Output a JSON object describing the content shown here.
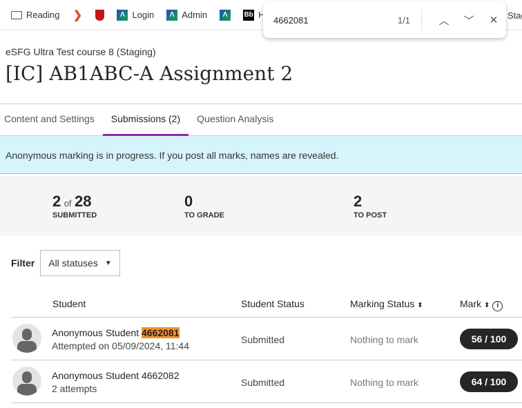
{
  "bookmarks": [
    {
      "label": "Reading",
      "icon": "folder-icon"
    },
    {
      "label": "",
      "icon": "red-chevron-icon"
    },
    {
      "label": "",
      "icon": "crest-icon"
    },
    {
      "label": "Login",
      "icon": "learn-icon"
    },
    {
      "label": "Admin",
      "icon": "learn-icon"
    },
    {
      "label": "",
      "icon": "learn-icon"
    },
    {
      "label": "Help",
      "icon": "bb-icon",
      "icon_text": "Bb"
    }
  ],
  "bookmark_overflow": "Stagin",
  "find": {
    "query": "4662081",
    "count": "1/1"
  },
  "course": "eSFG Ultra Test course 8 (Staging)",
  "title": "[IC] AB1ABC-A Assignment 2",
  "tabs": [
    {
      "label": "Content and Settings"
    },
    {
      "label": "Submissions (2)",
      "active": true
    },
    {
      "label": "Question Analysis"
    }
  ],
  "banner": "Anonymous marking is in progress. If you post all marks, names are revealed.",
  "stats": {
    "submitted": "2",
    "of": "of",
    "total": "28",
    "submitted_label": "SUBMITTED",
    "to_grade": "0",
    "to_grade_label": "TO GRADE",
    "to_post": "2",
    "to_post_label": "TO POST"
  },
  "filter": {
    "label": "Filter",
    "value": "All statuses"
  },
  "columns": {
    "student": "Student",
    "student_status": "Student Status",
    "marking_status": "Marking Status",
    "mark": "Mark"
  },
  "rows": [
    {
      "name": "Anonymous Student",
      "id": "4662081",
      "sub": "Attempted on 05/09/2024, 11:44",
      "student_status": "Submitted",
      "marking_status": "Nothing to mark",
      "mark": "56  / 100"
    },
    {
      "name": "Anonymous Student",
      "id": "4662082",
      "sub": "2 attempts",
      "student_status": "Submitted",
      "marking_status": "Nothing to mark",
      "mark": "64  / 100"
    }
  ],
  "colors": {
    "accent": "#8e27b3",
    "banner": "#d6f5fb",
    "highlight": "#f48f2d",
    "mark_pill": "#262626"
  }
}
